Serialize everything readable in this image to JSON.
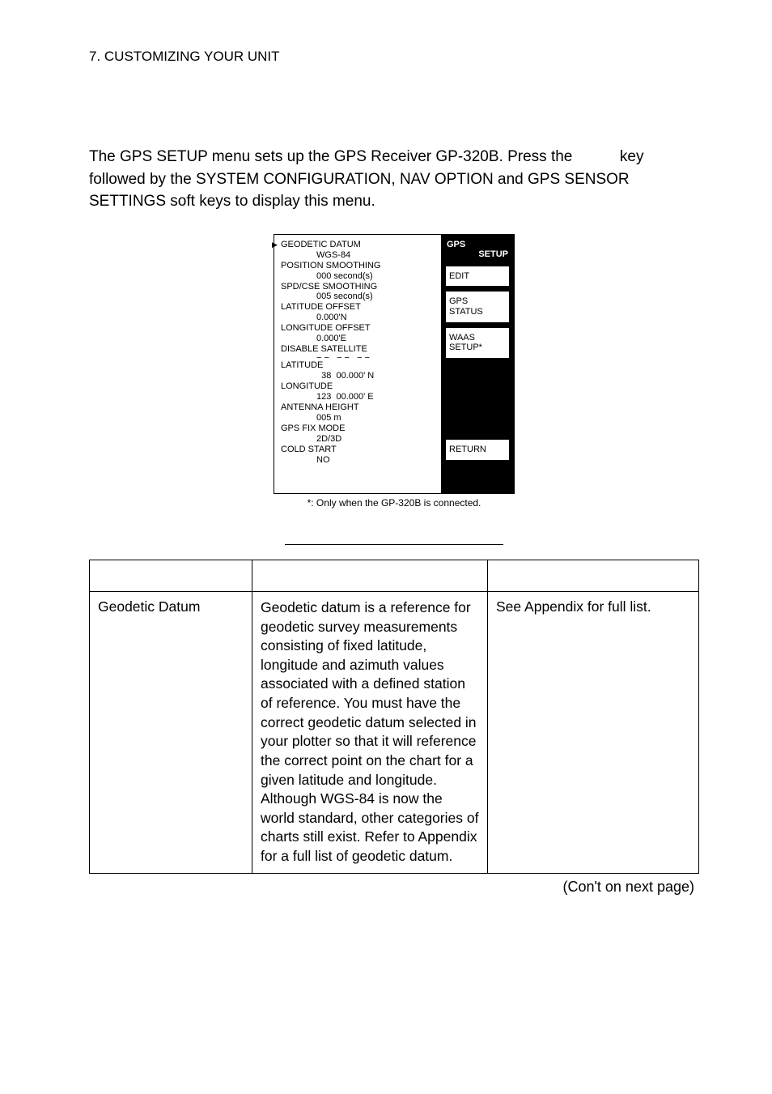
{
  "header": {
    "title": "7. CUSTOMIZING YOUR UNIT"
  },
  "intro": {
    "text_part1": "The GPS SETUP menu sets up the GPS Receiver GP-320B. Press the ",
    "text_part2": " key followed by the SYSTEM CONFIGURATION, NAV OPTION and GPS SENSOR SETTINGS soft keys to display this menu."
  },
  "screenshot": {
    "left": {
      "items": [
        {
          "label": "GEODETIC DATUM",
          "value": "WGS-84",
          "arrow": true
        },
        {
          "label": "POSITION SMOOTHING",
          "value": "000 second(s)"
        },
        {
          "label": "SPD/CSE SMOOTHING",
          "value": "005 second(s)"
        },
        {
          "label": "LATITUDE OFFSET",
          "value": "0.000'N"
        },
        {
          "label": "LONGITUDE OFFSET",
          "value": "0.000'E"
        },
        {
          "label": "DISABLE SATELLITE",
          "value": "− −   − −   − −"
        },
        {
          "label": "LATITUDE",
          "value": "  38  00.000' N",
          "overlap": true
        },
        {
          "label": "LONGITUDE",
          "value": "123  00.000' E"
        },
        {
          "label": "ANTENNA HEIGHT",
          "value": "005 m"
        },
        {
          "label": "GPS FIX MODE",
          "value": "2D/3D"
        },
        {
          "label": "COLD START",
          "value": "NO"
        }
      ]
    },
    "right": {
      "title_l1": "GPS",
      "title_l2": "SETUP",
      "softkeys": [
        {
          "lines": [
            "EDIT"
          ]
        },
        {
          "lines": [
            "GPS",
            "STATUS"
          ]
        },
        {
          "lines": [
            "WAAS",
            "SETUP*"
          ]
        }
      ],
      "return": "RETURN"
    }
  },
  "caption": {
    "text": "*: Only when the GP-320B is connected."
  },
  "table": {
    "headers": {
      "c1": "",
      "c2": "",
      "c3": ""
    },
    "row": {
      "item": "Geodetic Datum",
      "desc": "Geodetic datum is a reference for geodetic survey measurements consisting of fixed latitude, longitude and azimuth values associated with a defined station of reference. You must have the correct geodetic datum selected in your plotter so that it will reference the correct point on the chart for a given latitude and longitude. Although WGS-84 is now the world standard, other categories of charts still exist. Refer to Appendix for a full list of geodetic datum.",
      "opts": "See Appendix for full list."
    }
  },
  "footer": {
    "text": "(Con't on next page)"
  }
}
